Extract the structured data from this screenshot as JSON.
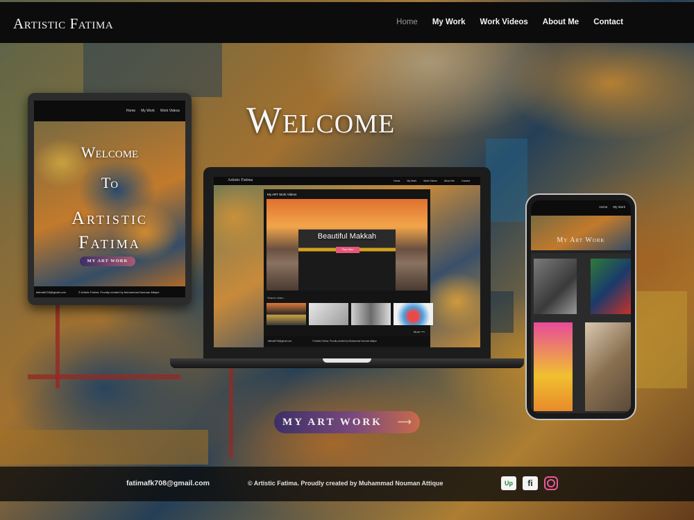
{
  "site": {
    "logo": "Artistic Fatima",
    "nav": [
      "Home",
      "My Work",
      "Work Videos",
      "About Me",
      "Contact"
    ],
    "active_nav": "Home"
  },
  "hero": {
    "welcome": "Welcome",
    "cta": "MY ART WORK",
    "cta_arrow": "⟶"
  },
  "footer": {
    "email": "fatimafk708@gmail.com",
    "copyright": "© Artistic Fatima. Proudly created by Muhammad Nouman Attique",
    "social": [
      "upwork-icon",
      "fiverr-icon",
      "instagram-icon"
    ],
    "upwork_text": "Up",
    "fiverr_text": "fi"
  },
  "tablet": {
    "nav": [
      "Home",
      "My Work",
      "Work Videos"
    ],
    "line1": "Welcome",
    "line2": "To",
    "line3": "Artistic",
    "line4": "Fatima",
    "cta": "MY ART WORK",
    "email": "fatimafk708@gmail.com",
    "copyright": "© Artistic Fatima. Proudly created by Muhammad Nouman Attique"
  },
  "laptop": {
    "site_title": "Artistic Fatima",
    "nav": [
      "Home",
      "My Work",
      "Work Videos",
      "About Me",
      "Contact"
    ],
    "modal_title": "My ART Work Videos",
    "video_title": "Beautiful Makkah",
    "play_label": "Play Video",
    "search_placeholder": "Search video...",
    "thumb_caption": "Beautiful Makkah",
    "more_label": "More ⟶",
    "email": "fatimafk708@gmail.com",
    "copyright": "© Artistic Fatima. Proudly created by Muhammad Nouman Attique"
  },
  "phone": {
    "nav": [
      "Home",
      "My Work"
    ],
    "title": "My Art Work"
  },
  "colors": {
    "header_bg": "#0c0c0c",
    "cta_start": "#3c2f66",
    "cta_end": "#c96a4a",
    "play_button": "#e8567a",
    "instagram": "#e85a9a",
    "upwork": "#1f8a3c"
  }
}
